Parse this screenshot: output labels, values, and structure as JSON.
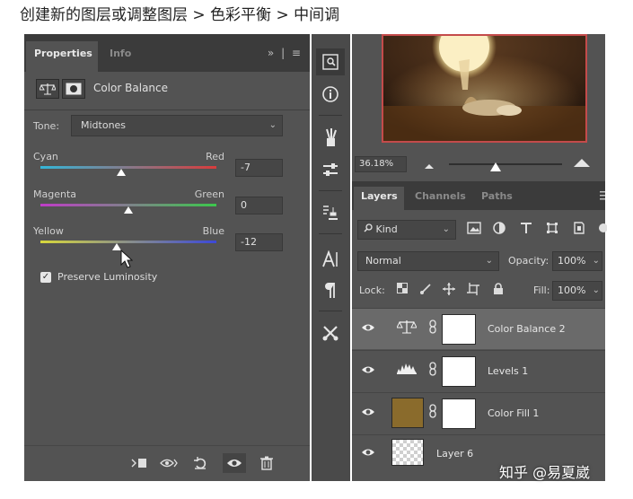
{
  "caption": "创建新的图层或调整图层 > 色彩平衡 > 中间调",
  "properties_panel": {
    "tabs": [
      "Properties",
      "Info"
    ],
    "menu": "» | ≡",
    "title": "Color Balance",
    "tone_label": "Tone:",
    "tone_value": "Midtones",
    "sliders": [
      {
        "left": "Cyan",
        "right": "Red",
        "value": "-7",
        "gradient": [
          "#34b6d8",
          "#d83c3c"
        ]
      },
      {
        "left": "Magenta",
        "right": "Green",
        "value": "0",
        "gradient": [
          "#c03cc8",
          "#3cc84c"
        ]
      },
      {
        "left": "Yellow",
        "right": "Blue",
        "value": "-12",
        "gradient": [
          "#d8d83c",
          "#3c48d8"
        ]
      }
    ],
    "preserve_luminosity": "Preserve Luminosity",
    "preserve_checked": true
  },
  "navigator": {
    "zoom": "36.18%"
  },
  "layers_panel": {
    "tabs": [
      "Layers",
      "Channels",
      "Paths"
    ],
    "kind": "Kind",
    "blend_mode": "Normal",
    "opacity_label": "Opacity:",
    "opacity_value": "100%",
    "lock_label": "Lock:",
    "fill_label": "Fill:",
    "fill_value": "100%",
    "layers": [
      {
        "name": "Color Balance 2",
        "type": "color-balance",
        "selected": true
      },
      {
        "name": "Levels 1",
        "type": "levels",
        "selected": false
      },
      {
        "name": "Color Fill 1",
        "type": "color-fill",
        "selected": false,
        "swatch": "#8a6b2c"
      },
      {
        "name": "Layer 6",
        "type": "pixel",
        "selected": false
      }
    ]
  },
  "watermark": "知乎 @易夏崴"
}
